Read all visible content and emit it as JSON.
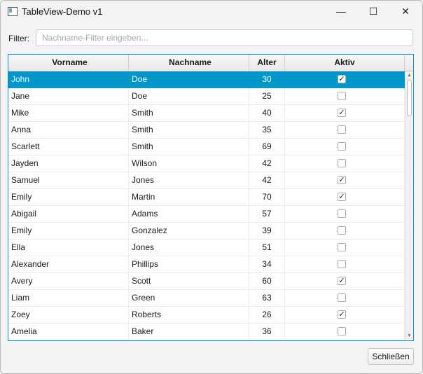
{
  "window": {
    "title": "TableView-Demo v1",
    "controls": {
      "minimize": "—",
      "maximize": "☐",
      "close": "✕"
    }
  },
  "filter": {
    "label": "Filter:",
    "value": "",
    "placeholder": "Nachname-Filter eingeben..."
  },
  "table": {
    "columns": [
      "Vorname",
      "Nachname",
      "Alter",
      "Aktiv"
    ],
    "selected_row": 0,
    "rows": [
      {
        "vorname": "John",
        "nachname": "Doe",
        "alter": "30",
        "aktiv": true
      },
      {
        "vorname": "Jane",
        "nachname": "Doe",
        "alter": "25",
        "aktiv": false
      },
      {
        "vorname": "Mike",
        "nachname": "Smith",
        "alter": "40",
        "aktiv": true
      },
      {
        "vorname": "Anna",
        "nachname": "Smith",
        "alter": "35",
        "aktiv": false
      },
      {
        "vorname": "Scarlett",
        "nachname": "Smith",
        "alter": "69",
        "aktiv": false
      },
      {
        "vorname": "Jayden",
        "nachname": "Wilson",
        "alter": "42",
        "aktiv": false
      },
      {
        "vorname": "Samuel",
        "nachname": "Jones",
        "alter": "42",
        "aktiv": true
      },
      {
        "vorname": "Emily",
        "nachname": "Martin",
        "alter": "70",
        "aktiv": true
      },
      {
        "vorname": "Abigail",
        "nachname": "Adams",
        "alter": "57",
        "aktiv": false
      },
      {
        "vorname": "Emily",
        "nachname": "Gonzalez",
        "alter": "39",
        "aktiv": false
      },
      {
        "vorname": "Ella",
        "nachname": "Jones",
        "alter": "51",
        "aktiv": false
      },
      {
        "vorname": "Alexander",
        "nachname": "Phillips",
        "alter": "34",
        "aktiv": false
      },
      {
        "vorname": "Avery",
        "nachname": "Scott",
        "alter": "60",
        "aktiv": true
      },
      {
        "vorname": "Liam",
        "nachname": "Green",
        "alter": "63",
        "aktiv": false
      },
      {
        "vorname": "Zoey",
        "nachname": "Roberts",
        "alter": "26",
        "aktiv": true
      },
      {
        "vorname": "Amelia",
        "nachname": "Baker",
        "alter": "36",
        "aktiv": false
      }
    ],
    "checkmark": "✓",
    "scroll": {
      "up_arrow": "▲",
      "down_arrow": "▼"
    }
  },
  "footer": {
    "close_label": "Schließen"
  },
  "colors": {
    "accent": "#0096c9",
    "background": "#f3f3f3"
  }
}
